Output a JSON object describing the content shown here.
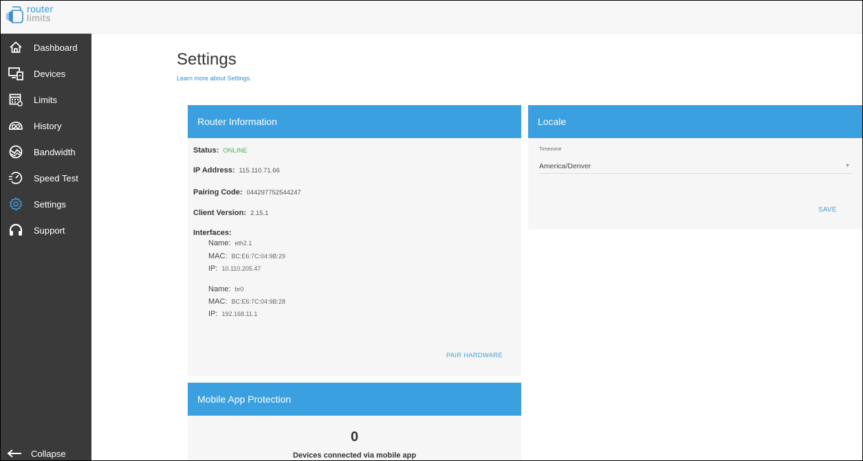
{
  "brand": {
    "line1": "router",
    "line2": "limits"
  },
  "sidebar": {
    "items": [
      {
        "label": "Dashboard",
        "icon": "home-icon"
      },
      {
        "label": "Devices",
        "icon": "devices-icon"
      },
      {
        "label": "Limits",
        "icon": "calendar-icon"
      },
      {
        "label": "History",
        "icon": "history-icon"
      },
      {
        "label": "Bandwidth",
        "icon": "bandwidth-icon"
      },
      {
        "label": "Speed Test",
        "icon": "speed-test-icon"
      },
      {
        "label": "Settings",
        "icon": "gear-icon",
        "active": true
      },
      {
        "label": "Support",
        "icon": "headset-icon"
      }
    ],
    "collapse_label": "Collapse"
  },
  "page": {
    "title": "Settings",
    "learn_more": "Learn more about Settings."
  },
  "router_info": {
    "header": "Router Information",
    "status_label": "Status:",
    "status_value": "ONLINE",
    "ip_label": "IP Address:",
    "ip_value": "115.110.71.66",
    "pairing_label": "Pairing Code:",
    "pairing_value": "044297752544247",
    "client_label": "Client Version:",
    "client_value": "2.15.1",
    "interfaces_label": "Interfaces:",
    "interfaces": [
      {
        "name_label": "Name:",
        "name": "eth2.1",
        "mac_label": "MAC:",
        "mac": "BC:E6:7C:04:9B:29",
        "ip_label": "IP:",
        "ip": "10.110.205.47"
      },
      {
        "name_label": "Name:",
        "name": "br0",
        "mac_label": "MAC:",
        "mac": "BC:E6:7C:04:9B:28",
        "ip_label": "IP:",
        "ip": "192.168.11.1"
      }
    ],
    "pair_button": "PAIR HARDWARE"
  },
  "locale": {
    "header": "Locale",
    "timezone_label": "Timezone",
    "timezone_value": "America/Denver",
    "save_button": "SAVE"
  },
  "mobile": {
    "header": "Mobile App Protection",
    "count": "0",
    "count_label": "Devices connected via mobile app"
  },
  "colors": {
    "accent": "#3aa0e0",
    "sidebar": "#3a3a3a",
    "online": "#4caf50",
    "link": "#2d8fd0"
  }
}
